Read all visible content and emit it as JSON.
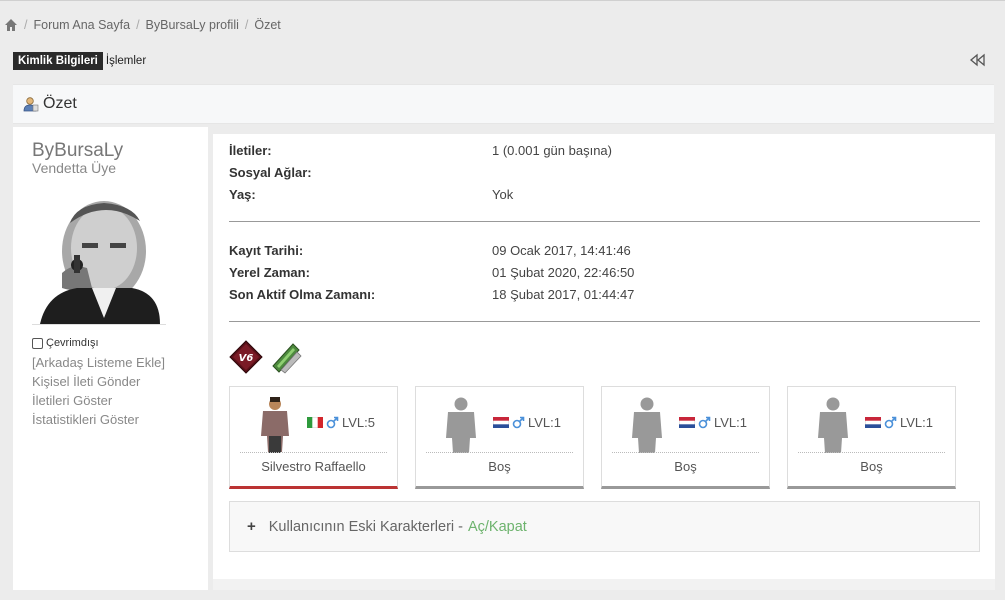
{
  "breadcrumb": {
    "items": [
      "Forum Ana Sayfa",
      "ByBursaLy profili",
      "Özet"
    ]
  },
  "tabs": {
    "active": "Kimlik Bilgileri",
    "other": "İşlemler"
  },
  "panel": {
    "title": "Özet"
  },
  "profile": {
    "username": "ByBursaLy",
    "user_title": "Vendetta Üye",
    "status": "Çevrimdışı",
    "links": [
      "[Arkadaş Listeme Ekle]",
      "Kişisel İleti Gönder",
      "İletileri Göster",
      "İstatistikleri Göster"
    ]
  },
  "stats": {
    "group1": [
      {
        "label": "İletiler:",
        "value": "1 (0.001 gün başına)"
      },
      {
        "label": "Sosyal Ağlar:",
        "value": ""
      },
      {
        "label": "Yaş:",
        "value": "Yok"
      }
    ],
    "group2": [
      {
        "label": "Kayıt Tarihi:",
        "value": "09 Ocak 2017, 14:41:46"
      },
      {
        "label": "Yerel Zaman:",
        "value": "01 Şubat 2020, 22:46:50"
      },
      {
        "label": "Son Aktif Olma Zamanı:",
        "value": "18 Şubat 2017, 01:44:47"
      }
    ]
  },
  "badges": [
    {
      "icon": "v6-badge-icon",
      "text": "V6"
    },
    {
      "icon": "money-badge-icon"
    }
  ],
  "characters": [
    {
      "name": "Silvestro Raffaello",
      "level": "LVL:5",
      "flag": "italy-flag-icon",
      "active": true
    },
    {
      "name": "Boş",
      "level": "LVL:1",
      "flag": "netherlands-flag-icon",
      "active": false
    },
    {
      "name": "Boş",
      "level": "LVL:1",
      "flag": "netherlands-flag-icon",
      "active": false
    },
    {
      "name": "Boş",
      "level": "LVL:1",
      "flag": "netherlands-flag-icon",
      "active": false
    }
  ],
  "old_characters": {
    "plus": "+",
    "label": "Kullanıcının Eski Karakterleri -",
    "toggle": "Aç/Kapat"
  },
  "colors": {
    "active_card_border": "#b33333",
    "toggle_link": "#6db36d"
  }
}
